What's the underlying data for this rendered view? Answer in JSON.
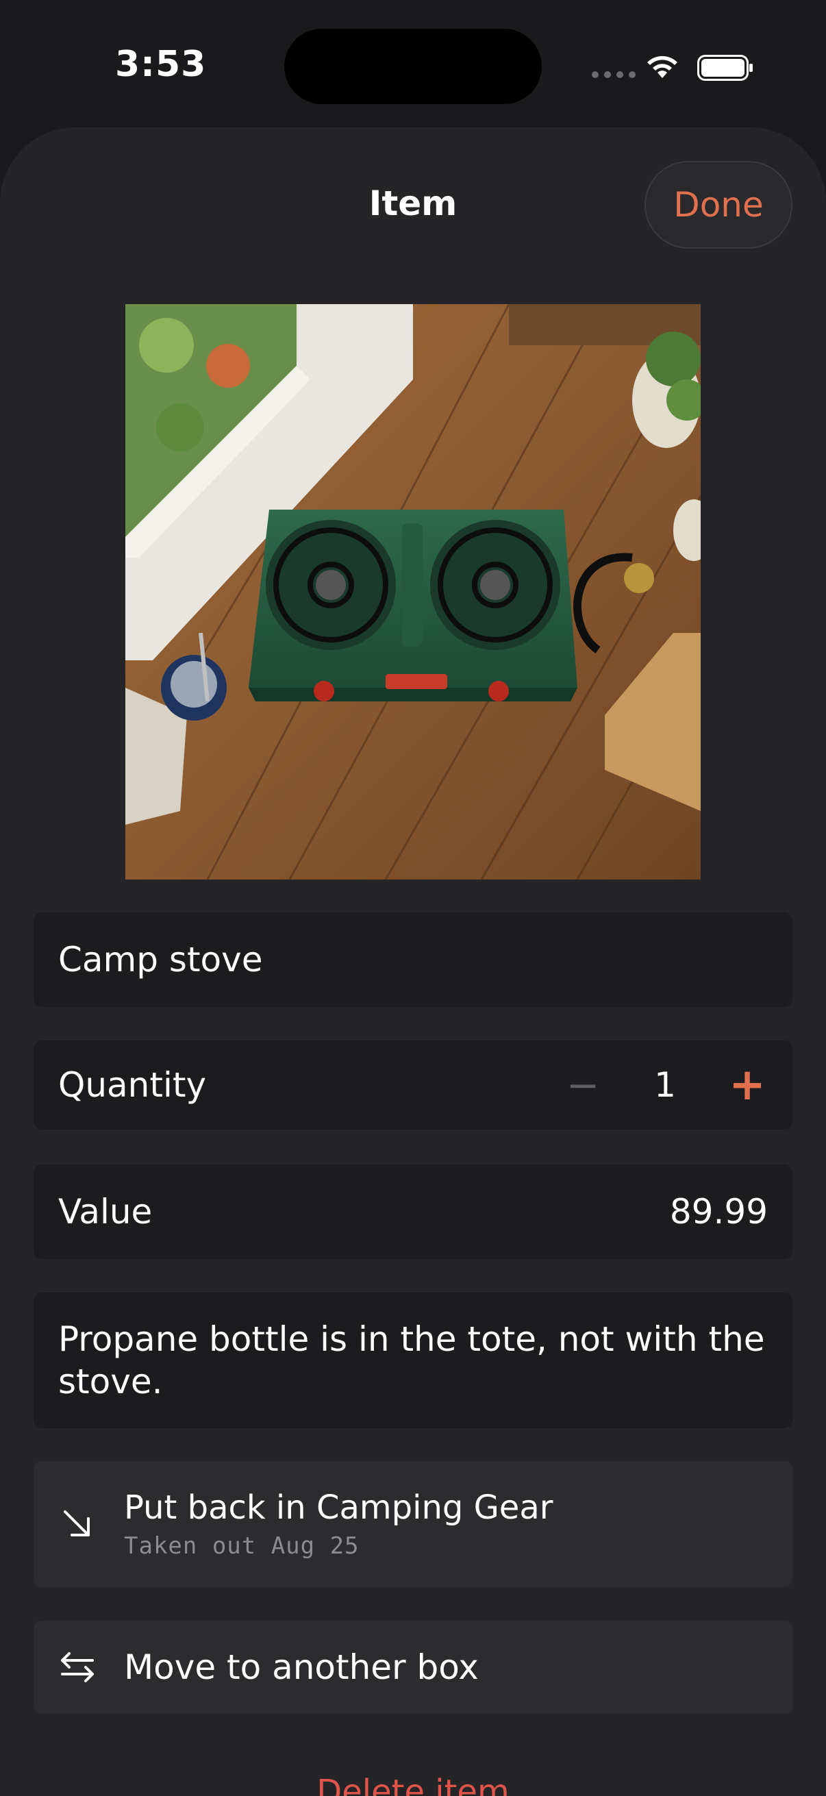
{
  "status_bar": {
    "time": "3:53"
  },
  "sheet": {
    "title": "Item",
    "done_label": "Done"
  },
  "item": {
    "name": "Camp stove",
    "quantity_label": "Quantity",
    "quantity": "1",
    "minus_symbol": "−",
    "plus_symbol": "+",
    "value_label": "Value",
    "value": "89.99",
    "notes": "Propane bottle is in the tote, not with the stove."
  },
  "actions": {
    "put_back_label": "Put back in Camping Gear",
    "put_back_sub": "Taken out Aug 25",
    "move_label": "Move to another box",
    "delete_label": "Delete item"
  },
  "colors": {
    "accent": "#e0704e",
    "destructive": "#e0544a",
    "sheet_bg": "#252528",
    "row_bg": "#1c1c1e"
  },
  "icons": {
    "put_back": "arrow-down-right-icon",
    "move": "arrows-left-right-icon"
  }
}
